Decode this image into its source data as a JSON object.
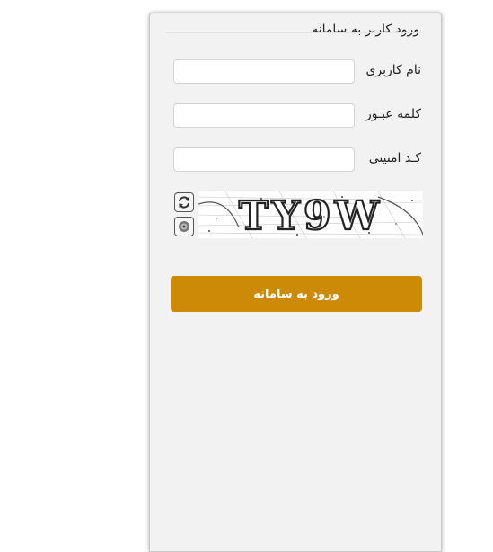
{
  "form": {
    "title": "ورود کاربر به سامانه",
    "username_label": "نام کاربری",
    "username_value": "",
    "password_label": "کلمه عبـور",
    "password_value": "",
    "security_label": "کـد امنیتی",
    "security_value": "",
    "captcha_text": "TY9W",
    "submit_label": "ورود به سامانه"
  },
  "icons": {
    "refresh": "refresh-icon",
    "audio": "speaker-icon"
  },
  "colors": {
    "accent": "#cc8a07",
    "panel_bg": "#f2f2f2"
  }
}
